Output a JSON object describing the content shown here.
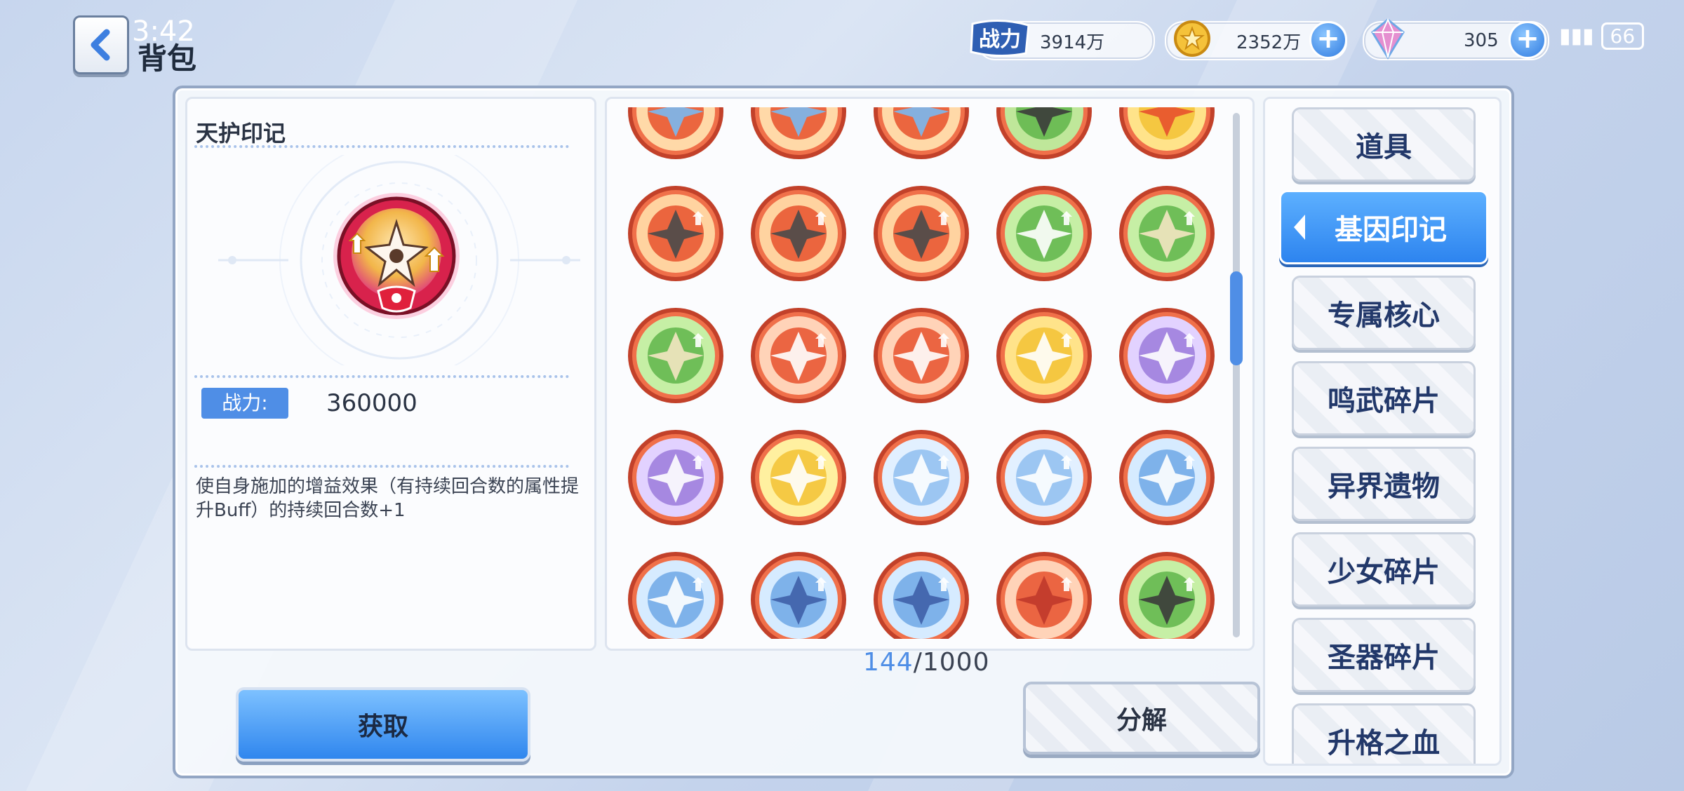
{
  "status_bar": {
    "time": "3:42",
    "battery": "66"
  },
  "header": {
    "title": "背包"
  },
  "resources": {
    "power_tag": "战力",
    "power_value": "3914万",
    "coins_value": "2352万",
    "gems_value": "305"
  },
  "detail": {
    "name": "天护印记",
    "power_label": "战力:",
    "power_value": "360000",
    "description": "使自身施加的增益效果（有持续回合数的属性提升Buff）的持续回合数+1"
  },
  "inventory": {
    "count_current": "144",
    "count_separator": "/",
    "count_max": "1000",
    "grid": [
      [
        "sword-emblem",
        "sword-emblem",
        "sword-emblem",
        "gun-emblem",
        "shield-cross-emblem"
      ],
      [
        "pistol-emblem",
        "pistol-emblem",
        "pistol-emblem",
        "plant-cross-emblem",
        "praying-hands-emblem"
      ],
      [
        "praying-hands-emblem",
        "chibi-eyepatch-emblem",
        "chibi-eyepatch-emblem",
        "arrow-down-emblem",
        "potion-emblem"
      ],
      [
        "potion-emblem",
        "lightning-person-emblem",
        "frost-figure-emblem",
        "frost-figure-emblem",
        "storm-arrow-emblem"
      ],
      [
        "storm-arrow-emblem",
        "chat-bubble-emblem",
        "chat-bubble-emblem",
        "angry-face-emblem",
        "rifle-emblem"
      ]
    ]
  },
  "buttons": {
    "get": "获取",
    "decompose": "分解"
  },
  "tabs": [
    {
      "label": "道具",
      "active": false
    },
    {
      "label": "基因印记",
      "active": true
    },
    {
      "label": "专属核心",
      "active": false
    },
    {
      "label": "鸣武碎片",
      "active": false
    },
    {
      "label": "异界遗物",
      "active": false
    },
    {
      "label": "少女碎片",
      "active": false
    },
    {
      "label": "圣器碎片",
      "active": false
    },
    {
      "label": "升格之血",
      "active": false
    }
  ],
  "colors": {
    "accent_blue": "#4f8ee6",
    "tab_text": "#22386a",
    "emblem_orange": "#e8512d",
    "emblem_green": "#5fb54a",
    "emblem_yellow": "#f3c234",
    "emblem_purple": "#9b7bdc",
    "emblem_ice": "#8fbef0"
  }
}
